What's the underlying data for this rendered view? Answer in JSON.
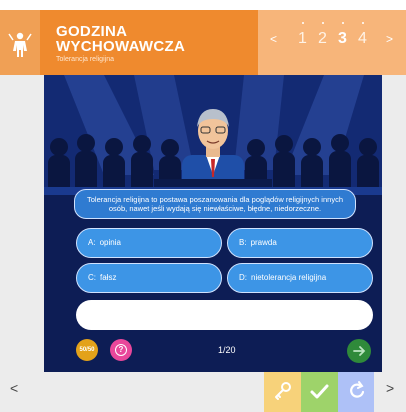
{
  "header": {
    "title_line1": "GODZINA",
    "title_line2": "WYCHOWAWCZA",
    "subtitle": "Tolerancja religijna",
    "nav_prev": "<",
    "nav_next": ">",
    "pages": [
      "1",
      "2",
      "3",
      "4"
    ],
    "active_page": "3",
    "icon": "presenter-icon"
  },
  "quiz": {
    "question": "Tolerancja religijna to postawa poszanowania dla poglądów religijnych innych osób, nawet jeśli wydają się niewłaściwe, błędne, niedorzeczne.",
    "answers": [
      {
        "key": "A:",
        "text": "opinia"
      },
      {
        "key": "B:",
        "text": "prawda"
      },
      {
        "key": "C:",
        "text": "fałsz"
      },
      {
        "key": "D:",
        "text": "nietolerancja religijna"
      }
    ],
    "answer_input_value": "",
    "lifeline_fifty": "50/50",
    "lifeline_help": "?",
    "counter": "1/20",
    "next_icon": "arrow-right-icon"
  },
  "footer": {
    "prev": "<",
    "next": ">",
    "key_icon": "key-icon",
    "check_icon": "check-icon",
    "reset_icon": "reset-icon"
  },
  "colors": {
    "header_orange": "#ef8a2e",
    "nav_orange": "#f7b57a",
    "stage_navy": "#0d1d55",
    "answer_blue": "#3d95e6",
    "question_blue": "#2f7bd1",
    "fifty_gold": "#e3a21a",
    "help_pink": "#e9479b",
    "next_green": "#2f8a3a",
    "key_yellow": "#f7d27a",
    "check_green": "#9ed36a",
    "reset_blue": "#aec1f7"
  }
}
